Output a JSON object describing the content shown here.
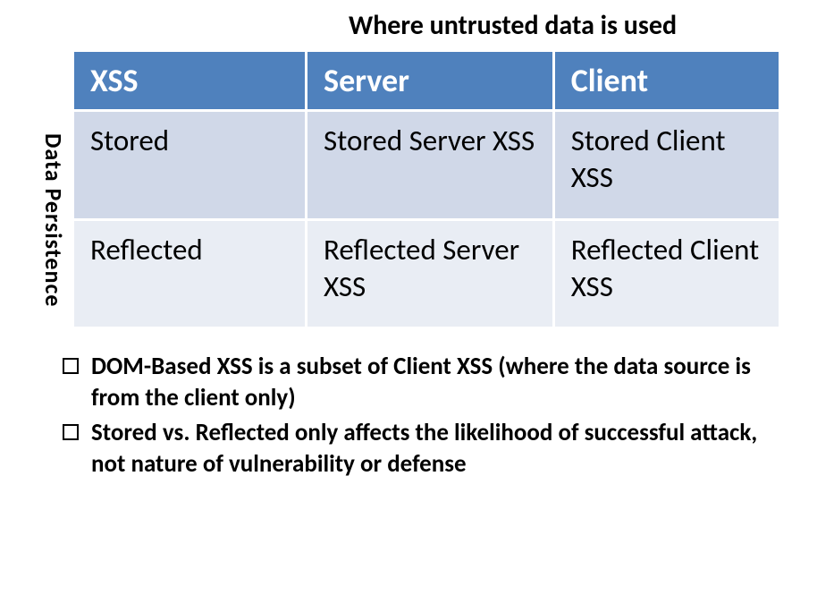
{
  "topTitle": "Where untrusted data is used",
  "sideLabel": "Data Persistence",
  "table": {
    "headers": {
      "c1": "XSS",
      "c2": "Server",
      "c3": "Client"
    },
    "rows": [
      {
        "c1": "Stored",
        "c2": "Stored Server XSS",
        "c3": "Stored Client XSS"
      },
      {
        "c1": "Reflected",
        "c2": "Reflected Server XSS",
        "c3": "Reflected Client XSS"
      }
    ]
  },
  "notes": [
    "DOM-Based XSS is a subset of Client XSS (where the data source is from the client only)",
    "Stored vs. Reflected only affects the likelihood of successful attack, not nature of vulnerability or defense"
  ],
  "chart_data": {
    "type": "table",
    "title_top": "Where untrusted data is used",
    "title_left": "Data Persistence",
    "columns": [
      "XSS",
      "Server",
      "Client"
    ],
    "rows": [
      [
        "Stored",
        "Stored Server XSS",
        "Stored Client XSS"
      ],
      [
        "Reflected",
        "Reflected Server XSS",
        "Reflected Client XSS"
      ]
    ]
  }
}
